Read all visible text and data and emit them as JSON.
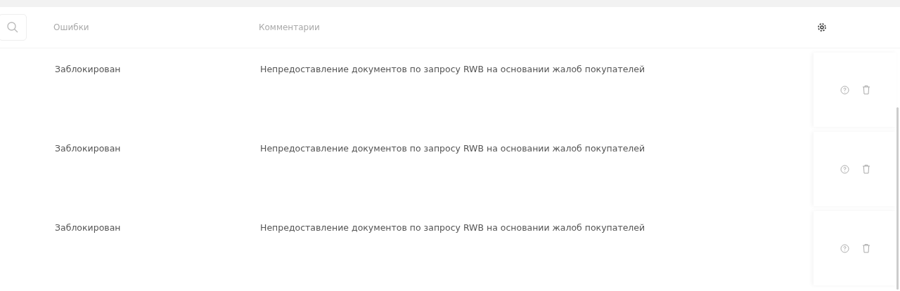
{
  "table": {
    "columns": [
      "Ошибки",
      "Комментарии"
    ],
    "rows": [
      {
        "error": "Заблокирован",
        "comment": "Непредоставление документов по запросу RWB на основании жалоб покупателей"
      },
      {
        "error": "Заблокирован",
        "comment": "Непредоставление документов по запросу RWB на основании жалоб покупателей"
      },
      {
        "error": "Заблокирован",
        "comment": "Непредоставление документов по запросу RWB на основании жалоб покупателей"
      }
    ]
  }
}
